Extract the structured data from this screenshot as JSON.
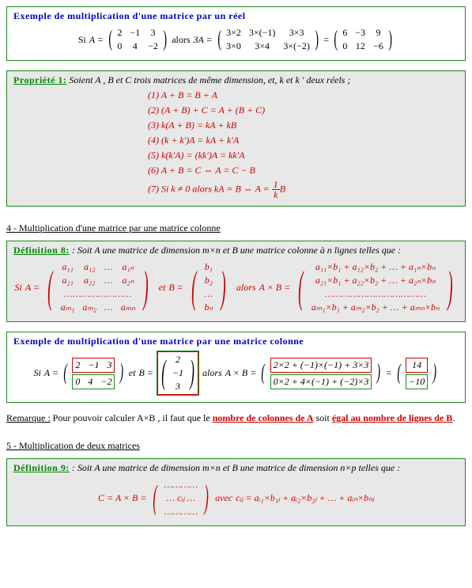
{
  "ex1": {
    "title": "Exemple de multiplication d'une matrice par un réel",
    "si": "Si",
    "A_eq": "A =",
    "A": [
      [
        "2",
        "−1",
        "3"
      ],
      [
        "0",
        "4",
        "−2"
      ]
    ],
    "alors": "alors",
    "three_A": "3A =",
    "calc": [
      [
        "3×2",
        "3×(−1)",
        "3×3"
      ],
      [
        "3×0",
        "3×4",
        "3×(−2)"
      ]
    ],
    "eq": "=",
    "result": [
      [
        "6",
        "−3",
        "9"
      ],
      [
        "0",
        "12",
        "−6"
      ]
    ]
  },
  "prop1": {
    "title": "Propriété 1:",
    "intro": "Soient A , B et C trois matrices de même dimension, et, k et k ' deux réels ;",
    "items": [
      "(1) A + B = B + A",
      "(2) (A + B) + C = A + (B + C)",
      "(3) k(A + B) = kA + kB",
      "(4) (k + k')A = kA + k'A",
      "(5) k(k'A) = (kk')A = kk'A",
      "(6) A + B = C ⇔ A = C − B",
      "(7) Si k ≠ 0 alors kA = B ⇔ A = "
    ],
    "frac_num": "1",
    "frac_den": "k",
    "frac_tail": "B"
  },
  "sec4": {
    "title": "4 - Multiplication d'une matrice par une matrice colonne"
  },
  "def8": {
    "title": "Définition 8:",
    "intro": " : Soit A une matrice de dimension m×n et B une matrice colonne à n lignes telles que :",
    "si": "Si",
    "A_eq": "A =",
    "A": [
      [
        "a₁₁",
        "a₁₂",
        "…",
        "a₁ₙ"
      ],
      [
        "a₂₁",
        "a₂₂",
        "…",
        "a₂ₙ"
      ],
      [
        "……………………"
      ],
      [
        "aₘ₁",
        "aₘ₂",
        "…",
        "aₘₙ"
      ]
    ],
    "et": "et",
    "B_eq": "B =",
    "B": [
      "b₁",
      "b₂",
      "…",
      "bₙ"
    ],
    "alors": "alors",
    "AB_eq": "A × B =",
    "AB": [
      "a₁₁×b₁ + a₁₂×b₂ + … + a₁ₙ×bₙ",
      "a₂₁×b₁ + a₂₂×b₂ + … + a₂ₙ×bₙ",
      "………………………………",
      "aₘ₁×b₁ + aₘ₂×b₂ + … + aₘₙ×bₙ"
    ]
  },
  "ex2": {
    "title": "Exemple de multiplication d'une matrice par une matrice colonne",
    "si": "Si",
    "A_eq": "A =",
    "A": [
      [
        "2",
        "−1",
        "3"
      ],
      [
        "0",
        "4",
        "−2"
      ]
    ],
    "et": "et",
    "B_eq": "B =",
    "B": [
      "2",
      "−1",
      "3"
    ],
    "alors": "alors",
    "AB_eq": "A × B =",
    "calc": [
      "2×2 + (−1)×(−1) + 3×3",
      "0×2 + 4×(−1) + (−2)×3"
    ],
    "eq": "=",
    "result": [
      "14",
      "−10"
    ]
  },
  "remarque": {
    "label": "Remarque :",
    "text1": "Pour pouvoir calculer A×B , il faut que le ",
    "strong1": "nombre de colonnes de A",
    "text2": " soit ",
    "strong2": "égal au nombre de lignes de B",
    "period": "."
  },
  "sec5": {
    "title": "5 - Multiplication de deux matrices"
  },
  "def9": {
    "title": "Définition 9:",
    "intro": " : Soit A une matrice de dimension m×n et B une matrice de dimension n×p telles que :",
    "C_eq": "C = A × B =",
    "C": [
      "…………",
      "… cᵢⱼ …",
      "…………"
    ],
    "avec": "avec",
    "formula": "cᵢⱼ = aᵢ₁×b₁ⱼ + aᵢ₂×b₂ⱼ + … + aᵢₙ×bₙⱼ"
  }
}
